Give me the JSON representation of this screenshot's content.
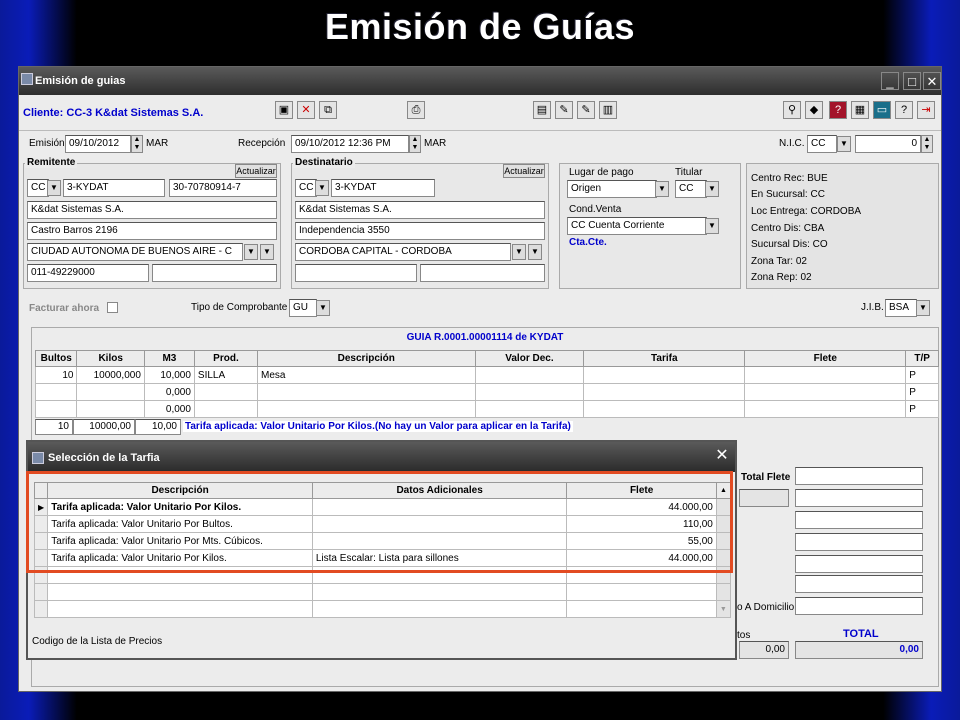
{
  "slide_title": "Emisión de Guías",
  "window": {
    "title": "Emisión de guias"
  },
  "cliente": "Cliente: CC-3 K&dat Sistemas S.A.",
  "emision": {
    "label": "Emisión",
    "date": "09/10/2012",
    "day": "MAR"
  },
  "recepcion": {
    "label": "Recepción",
    "datetime": "09/10/2012 12:36 PM",
    "day": "MAR"
  },
  "nic": {
    "label": "N.I.C.",
    "value": "CC",
    "number": "0"
  },
  "remitente": {
    "title": "Remitente",
    "btn": "Actualizar",
    "type": "CC",
    "code": "3-KYDAT",
    "cuit": "30-70780914-7",
    "name": "K&dat Sistemas S.A.",
    "address": "Castro Barros 2196",
    "city": "CIUDAD AUTONOMA DE BUENOS AIRE - C",
    "phone": "011-49229000"
  },
  "destinatario": {
    "title": "Destinatario",
    "btn": "Actualizar",
    "type": "CC",
    "code": "3-KYDAT",
    "name": "K&dat Sistemas S.A.",
    "address": "Independencia 3550",
    "city": "CORDOBA CAPITAL - CORDOBA"
  },
  "pago": {
    "lugar_label": "Lugar de pago",
    "lugar": "Origen",
    "titular_label": "Titular",
    "titular": "CC",
    "cond_label": "Cond.Venta",
    "cond": "CC Cuenta Corriente",
    "cta": "Cta.Cte."
  },
  "centro": [
    "Centro Rec: BUE",
    "En Sucursal: CC",
    "Loc Entrega: CORDOBA",
    "Centro Dis: CBA",
    "Sucursal Dis: CO",
    "Zona Tar: 02",
    "Zona Rep: 02"
  ],
  "facturar": "Facturar ahora",
  "comprobante": {
    "label": "Tipo de Comprobante",
    "value": "GU"
  },
  "jib": {
    "label": "J.I.B.",
    "value": "BSA"
  },
  "guia_title": "GUIA R.0001.00001114 de KYDAT",
  "grid": {
    "headers": [
      "Bultos",
      "Kilos",
      "M3",
      "Prod.",
      "Descripción",
      "Valor Dec.",
      "Tarifa",
      "Flete",
      "T/P"
    ],
    "rows": [
      [
        "10",
        "10000,000",
        "10,000",
        "SILLA",
        "Mesa",
        "",
        "",
        "",
        "P"
      ],
      [
        "",
        "",
        "0,000",
        "",
        "",
        "",
        "",
        "",
        "P"
      ],
      [
        "",
        "",
        "0,000",
        "",
        "",
        "",
        "",
        "",
        "P"
      ]
    ],
    "totals": {
      "bultos": "10",
      "kilos": "10000,00",
      "m3": "10,00"
    },
    "tarifa_aplicada": "Tarifa aplicada: Valor Unitario Por Kilos.(No hay un Valor para aplicar en la Tarifa)"
  },
  "right": {
    "total_flete": "Total Flete",
    "domicilio": "o A Domicilio",
    "tos": "tos",
    "total": "TOTAL",
    "v1": "0,00",
    "v2": "0,00"
  },
  "dialog": {
    "title": "Selección de la Tarfia",
    "headers": [
      "Descripción",
      "Datos Adicionales",
      "Flete"
    ],
    "rows": [
      [
        "Tarifa aplicada: Valor Unitario Por Kilos.",
        "",
        "44.000,00"
      ],
      [
        "Tarifa aplicada: Valor Unitario Por Bultos.",
        "",
        "110,00"
      ],
      [
        "Tarifa aplicada: Valor Unitario Por Mts. Cúbicos.",
        "",
        "55,00"
      ],
      [
        "Tarifa aplicada: Valor Unitario Por Kilos.",
        "Lista Escalar: Lista para sillones",
        "44.000,00"
      ]
    ],
    "status": "Codigo de la Lista de Precios"
  },
  "colors": {
    "highlight": "#e24b22",
    "link_blue": "#0000cc"
  }
}
